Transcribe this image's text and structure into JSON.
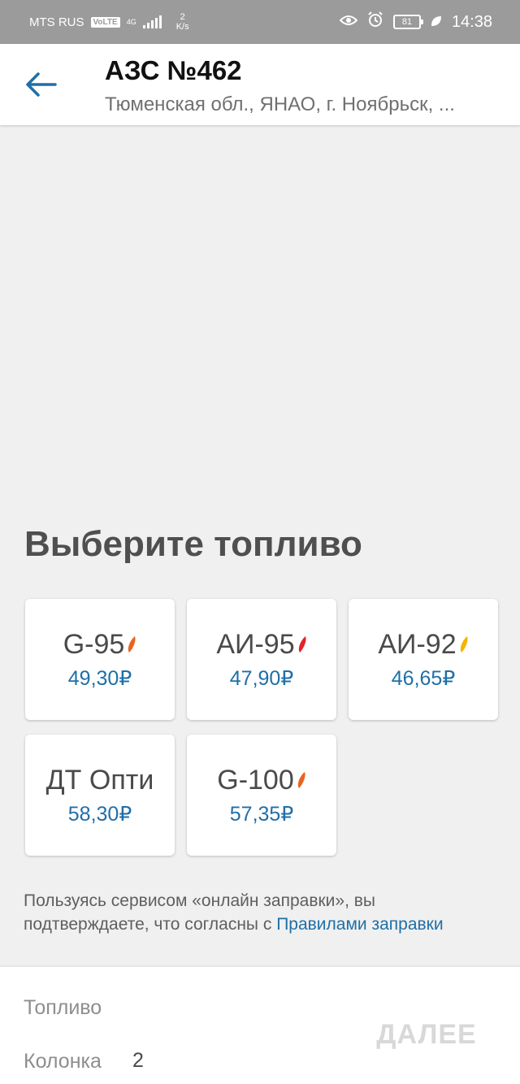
{
  "status_bar": {
    "carrier": "MTS RUS",
    "volte": "VoLTE",
    "network": "4G",
    "speed_value": "2",
    "speed_unit": "K/s",
    "battery": "81",
    "time": "14:38"
  },
  "header": {
    "title": "АЗС №462",
    "address": "Тюменская обл., ЯНАО, г. Ноябрьск, ..."
  },
  "fuel_section": {
    "title": "Выберите топливо",
    "fuels": [
      {
        "name": "G-95",
        "price": "49,30₽",
        "drop_color": "#e8641e"
      },
      {
        "name": "АИ-95",
        "price": "47,90₽",
        "drop_color": "#e0242a"
      },
      {
        "name": "АИ-92",
        "price": "46,65₽",
        "drop_color": "#f4b400"
      },
      {
        "name": "ДТ Опти",
        "price": "58,30₽",
        "drop_color": null
      },
      {
        "name": "G-100",
        "price": "57,35₽",
        "drop_color": "#e8641e"
      }
    ]
  },
  "agreement": {
    "text": "Пользуясь сервисом «онлайн заправки», вы подтверждаете, что согласны с ",
    "link": "Правилами заправки"
  },
  "bottom_panel": {
    "fuel_label": "Топливо",
    "column_label": "Колонка",
    "column_value": "2",
    "next_label": "ДАЛЕЕ"
  },
  "colors": {
    "accent": "#1f6fa8",
    "disabled_button": "#d8d8d8"
  }
}
